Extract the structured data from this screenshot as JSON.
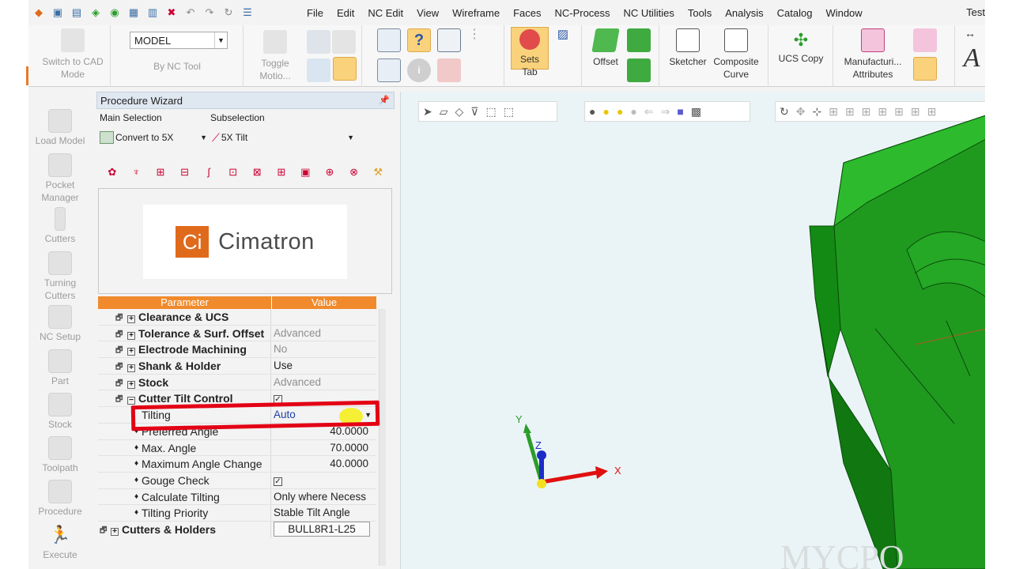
{
  "menu": [
    "File",
    "Edit",
    "NC Edit",
    "View",
    "Wireframe",
    "Faces",
    "NC-Process",
    "NC Utilities",
    "Tools",
    "Analysis",
    "Catalog",
    "Window"
  ],
  "window_title_partial": "Test",
  "ribbon": {
    "switch_to_cad": "Switch to CAD Mode",
    "model_select": "MODEL",
    "by_nc_tool": "By NC Tool",
    "toggle_motion": "Toggle Motio...",
    "sets_tab": "Sets Tab",
    "offset": "Offset",
    "sketcher": "Sketcher",
    "composite_curve": "Composite Curve",
    "ucs_copy": "UCS Copy",
    "manufacturing_attributes": "Manufacturi... Attributes"
  },
  "left_panel": [
    "Load Model",
    "Pocket Manager",
    "Cutters",
    "Turning Cutters",
    "NC Setup",
    "Part",
    "Stock",
    "Toolpath",
    "Procedure",
    "Execute"
  ],
  "wizard": {
    "title": "Procedure Wizard",
    "main_selection_label": "Main Selection",
    "subselection_label": "Subselection",
    "main_selection_value": "Convert to 5X",
    "subselection_value": "5X Tilt",
    "logo_ci": "Ci",
    "logo_text": "Cimatron",
    "table": {
      "headers": [
        "Parameter",
        "Value"
      ],
      "rows": [
        {
          "param": "Clearance & UCS",
          "value": "",
          "bold": true
        },
        {
          "param": "Tolerance & Surf. Offset",
          "value": "Advanced",
          "bold": true
        },
        {
          "param": "Electrode Machining",
          "value": "No",
          "bold": true
        },
        {
          "param": "Shank & Holder",
          "value": "Use",
          "bold": true
        },
        {
          "param": "Stock",
          "value": "Advanced",
          "bold": true
        },
        {
          "param": "Cutter Tilt Control",
          "value": "checked",
          "bold": true
        },
        {
          "param": "Tilting",
          "value": "Auto",
          "bold": false
        },
        {
          "param": "Preferred Angle",
          "value": "40.0000",
          "bold": false
        },
        {
          "param": "Max. Angle",
          "value": "70.0000",
          "bold": false
        },
        {
          "param": "Maximum Angle Change",
          "value": "40.0000",
          "bold": false
        },
        {
          "param": "Gouge Check",
          "value": "checked",
          "bold": false
        },
        {
          "param": "Calculate Tilting",
          "value": "Only where Necess",
          "bold": false
        },
        {
          "param": "Tilting Priority",
          "value": "Stable Tilt Angle",
          "bold": false
        },
        {
          "param": "Cutters & Holders",
          "value": "BULL8R1-L25",
          "bold": true
        }
      ]
    }
  },
  "viewport": {
    "axis_x": "X",
    "axis_y": "Y",
    "axis_z": "Z",
    "watermark": "MYCPO"
  },
  "colors": {
    "accent_orange": "#f08a2c",
    "highlight_red": "#e30015",
    "model_green": "#1a8c1a"
  }
}
